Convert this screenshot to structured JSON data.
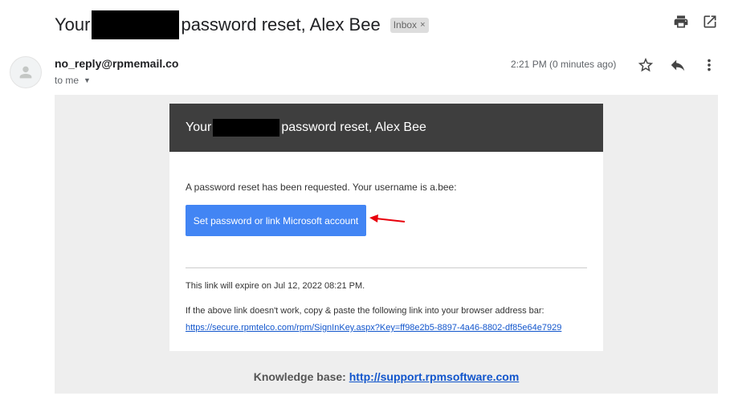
{
  "subject": {
    "prefix": "Your",
    "suffix": "password reset, Alex Bee",
    "label_chip": "Inbox",
    "label_remove": "×"
  },
  "toolbar": {
    "icons": [
      "print-icon",
      "open-in-new-window-icon"
    ]
  },
  "message": {
    "sender": "no_reply@rpmemail.co",
    "recipient": "to me",
    "timestamp": "2:21 PM (0 minutes ago)",
    "actions": [
      "star-icon",
      "reply-icon",
      "more-vertical-icon"
    ]
  },
  "email_body": {
    "header_prefix": "Your",
    "header_suffix": "password reset, Alex Bee",
    "intro": "A password reset has been requested. Your username is a.bee:",
    "cta_label": "Set password or link Microsoft account",
    "expiry": "This link will expire on Jul 12, 2022 08:21 PM.",
    "fallback_text": "If the above link doesn't work, copy & paste the following link into your browser address bar:",
    "reset_link": "https://secure.rpmtelco.com/rpm/SignInKey.aspx?Key=ff98e2b5-8897-4a46-8802-df85e64e7929",
    "kb_label": "Knowledge base:",
    "kb_link": "http://support.rpmsoftware.com"
  },
  "colors": {
    "header_bg": "#3e3e3e",
    "button_bg": "#4285f4",
    "link": "#1155cc",
    "annotation_arrow": "#e8000b",
    "canvas_bg": "#eeeeee"
  }
}
